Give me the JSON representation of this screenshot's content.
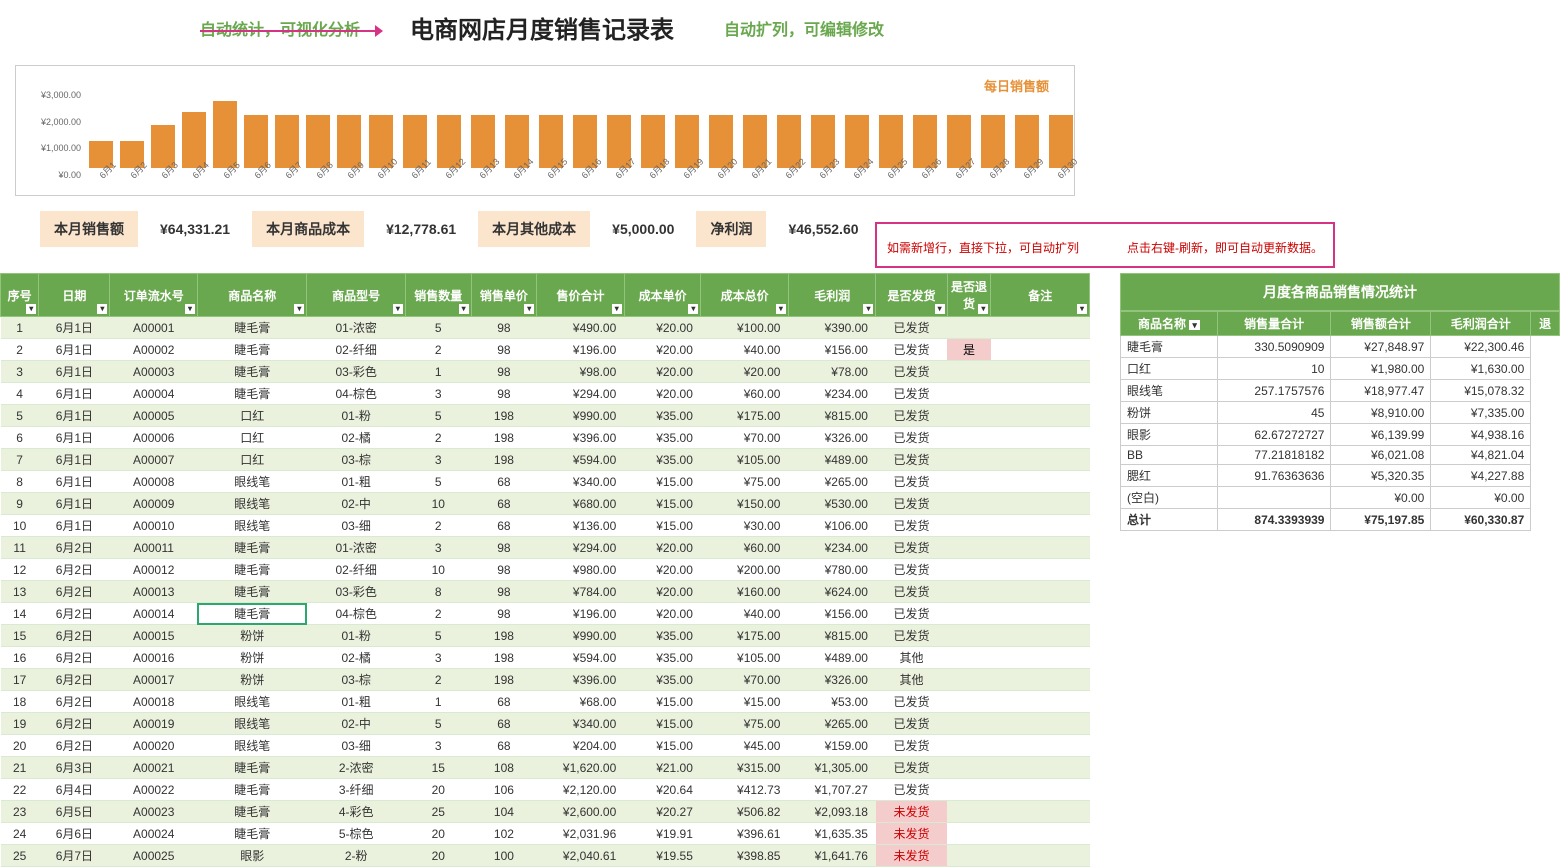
{
  "titles": {
    "note_left": "自动统计，可视化分析",
    "main": "电商网店月度销售记录表",
    "note_right": "自动扩列，可编辑修改"
  },
  "chart": {
    "legend": "每日销售额",
    "y_ticks": [
      "¥3,000.00",
      "¥2,000.00",
      "¥1,000.00",
      "¥0.00"
    ]
  },
  "chart_data": {
    "type": "bar",
    "title": "每日销售额",
    "xlabel": "",
    "ylabel": "",
    "ylim": [
      0,
      3000
    ],
    "categories": [
      "6月1",
      "6月2",
      "6月3",
      "6月4",
      "6月5",
      "6月6",
      "6月7",
      "6月8",
      "6月9",
      "6月10",
      "6月11",
      "6月12",
      "6月13",
      "6月14",
      "6月15",
      "6月16",
      "6月17",
      "6月18",
      "6月19",
      "6月20",
      "6月21",
      "6月22",
      "6月23",
      "6月24",
      "6月25",
      "6月26",
      "6月27",
      "6月28",
      "6月29",
      "6月30"
    ],
    "values": [
      1000,
      1000,
      1600,
      2100,
      2500,
      2000,
      2000,
      2000,
      2000,
      2000,
      2000,
      2000,
      2000,
      2000,
      2000,
      2000,
      2000,
      2000,
      2000,
      2000,
      2000,
      2000,
      2000,
      2000,
      2000,
      2000,
      2000,
      2000,
      2000,
      2000
    ]
  },
  "summary": {
    "labels": [
      "本月销售额",
      "本月商品成本",
      "本月其他成本",
      "净利润"
    ],
    "values": [
      "¥64,331.21",
      "¥12,778.61",
      "¥5,000.00",
      "¥46,552.60"
    ]
  },
  "red_notes": {
    "left": "如需新增行，直接下拉，可自动扩列",
    "right": "点击右键-刷新，即可自动更新数据。"
  },
  "main_table": {
    "headers": [
      "序号",
      "日期",
      "订单流水号",
      "商品名称",
      "商品型号",
      "销售数量",
      "销售单价",
      "售价合计",
      "成本单价",
      "成本总价",
      "毛利润",
      "是否发货",
      "是否退货",
      "备注"
    ],
    "rows": [
      [
        "1",
        "6月1日",
        "A00001",
        "睫毛膏",
        "01-浓密",
        "5",
        "98",
        "¥490.00",
        "¥20.00",
        "¥100.00",
        "¥390.00",
        "已发货",
        "",
        ""
      ],
      [
        "2",
        "6月1日",
        "A00002",
        "睫毛膏",
        "02-纤细",
        "2",
        "98",
        "¥196.00",
        "¥20.00",
        "¥40.00",
        "¥156.00",
        "已发货",
        "是",
        ""
      ],
      [
        "3",
        "6月1日",
        "A00003",
        "睫毛膏",
        "03-彩色",
        "1",
        "98",
        "¥98.00",
        "¥20.00",
        "¥20.00",
        "¥78.00",
        "已发货",
        "",
        ""
      ],
      [
        "4",
        "6月1日",
        "A00004",
        "睫毛膏",
        "04-棕色",
        "3",
        "98",
        "¥294.00",
        "¥20.00",
        "¥60.00",
        "¥234.00",
        "已发货",
        "",
        ""
      ],
      [
        "5",
        "6月1日",
        "A00005",
        "口红",
        "01-粉",
        "5",
        "198",
        "¥990.00",
        "¥35.00",
        "¥175.00",
        "¥815.00",
        "已发货",
        "",
        ""
      ],
      [
        "6",
        "6月1日",
        "A00006",
        "口红",
        "02-橘",
        "2",
        "198",
        "¥396.00",
        "¥35.00",
        "¥70.00",
        "¥326.00",
        "已发货",
        "",
        ""
      ],
      [
        "7",
        "6月1日",
        "A00007",
        "口红",
        "03-棕",
        "3",
        "198",
        "¥594.00",
        "¥35.00",
        "¥105.00",
        "¥489.00",
        "已发货",
        "",
        ""
      ],
      [
        "8",
        "6月1日",
        "A00008",
        "眼线笔",
        "01-粗",
        "5",
        "68",
        "¥340.00",
        "¥15.00",
        "¥75.00",
        "¥265.00",
        "已发货",
        "",
        ""
      ],
      [
        "9",
        "6月1日",
        "A00009",
        "眼线笔",
        "02-中",
        "10",
        "68",
        "¥680.00",
        "¥15.00",
        "¥150.00",
        "¥530.00",
        "已发货",
        "",
        ""
      ],
      [
        "10",
        "6月1日",
        "A00010",
        "眼线笔",
        "03-细",
        "2",
        "68",
        "¥136.00",
        "¥15.00",
        "¥30.00",
        "¥106.00",
        "已发货",
        "",
        ""
      ],
      [
        "11",
        "6月2日",
        "A00011",
        "睫毛膏",
        "01-浓密",
        "3",
        "98",
        "¥294.00",
        "¥20.00",
        "¥60.00",
        "¥234.00",
        "已发货",
        "",
        ""
      ],
      [
        "12",
        "6月2日",
        "A00012",
        "睫毛膏",
        "02-纤细",
        "10",
        "98",
        "¥980.00",
        "¥20.00",
        "¥200.00",
        "¥780.00",
        "已发货",
        "",
        ""
      ],
      [
        "13",
        "6月2日",
        "A00013",
        "睫毛膏",
        "03-彩色",
        "8",
        "98",
        "¥784.00",
        "¥20.00",
        "¥160.00",
        "¥624.00",
        "已发货",
        "",
        ""
      ],
      [
        "14",
        "6月2日",
        "A00014",
        "睫毛膏",
        "04-棕色",
        "2",
        "98",
        "¥196.00",
        "¥20.00",
        "¥40.00",
        "¥156.00",
        "已发货",
        "",
        ""
      ],
      [
        "15",
        "6月2日",
        "A00015",
        "粉饼",
        "01-粉",
        "5",
        "198",
        "¥990.00",
        "¥35.00",
        "¥175.00",
        "¥815.00",
        "已发货",
        "",
        ""
      ],
      [
        "16",
        "6月2日",
        "A00016",
        "粉饼",
        "02-橘",
        "3",
        "198",
        "¥594.00",
        "¥35.00",
        "¥105.00",
        "¥489.00",
        "其他",
        "",
        ""
      ],
      [
        "17",
        "6月2日",
        "A00017",
        "粉饼",
        "03-棕",
        "2",
        "198",
        "¥396.00",
        "¥35.00",
        "¥70.00",
        "¥326.00",
        "其他",
        "",
        ""
      ],
      [
        "18",
        "6月2日",
        "A00018",
        "眼线笔",
        "01-粗",
        "1",
        "68",
        "¥68.00",
        "¥15.00",
        "¥15.00",
        "¥53.00",
        "已发货",
        "",
        ""
      ],
      [
        "19",
        "6月2日",
        "A00019",
        "眼线笔",
        "02-中",
        "5",
        "68",
        "¥340.00",
        "¥15.00",
        "¥75.00",
        "¥265.00",
        "已发货",
        "",
        ""
      ],
      [
        "20",
        "6月2日",
        "A00020",
        "眼线笔",
        "03-细",
        "3",
        "68",
        "¥204.00",
        "¥15.00",
        "¥45.00",
        "¥159.00",
        "已发货",
        "",
        ""
      ],
      [
        "21",
        "6月3日",
        "A00021",
        "睫毛膏",
        "2-浓密",
        "15",
        "108",
        "¥1,620.00",
        "¥21.00",
        "¥315.00",
        "¥1,305.00",
        "已发货",
        "",
        ""
      ],
      [
        "22",
        "6月4日",
        "A00022",
        "睫毛膏",
        "3-纤细",
        "20",
        "106",
        "¥2,120.00",
        "¥20.64",
        "¥412.73",
        "¥1,707.27",
        "已发货",
        "",
        ""
      ],
      [
        "23",
        "6月5日",
        "A00023",
        "睫毛膏",
        "4-彩色",
        "25",
        "104",
        "¥2,600.00",
        "¥20.27",
        "¥506.82",
        "¥2,093.18",
        "未发货",
        "",
        ""
      ],
      [
        "24",
        "6月6日",
        "A00024",
        "睫毛膏",
        "5-棕色",
        "20",
        "102",
        "¥2,031.96",
        "¥19.91",
        "¥396.61",
        "¥1,635.35",
        "未发货",
        "",
        ""
      ],
      [
        "25",
        "6月7日",
        "A00025",
        "眼影",
        "2-粉",
        "20",
        "100",
        "¥2,040.61",
        "¥19.55",
        "¥398.85",
        "¥1,641.76",
        "未发货",
        "",
        ""
      ]
    ]
  },
  "pivot": {
    "title": "月度各商品销售情况统计",
    "headers": [
      "商品名称",
      "销售量合计",
      "销售额合计",
      "毛利润合计",
      "退"
    ],
    "rows": [
      [
        "睫毛膏",
        "330.5090909",
        "¥27,848.97",
        "¥22,300.46"
      ],
      [
        "口红",
        "10",
        "¥1,980.00",
        "¥1,630.00"
      ],
      [
        "眼线笔",
        "257.1757576",
        "¥18,977.47",
        "¥15,078.32"
      ],
      [
        "粉饼",
        "45",
        "¥8,910.00",
        "¥7,335.00"
      ],
      [
        "眼影",
        "62.67272727",
        "¥6,139.99",
        "¥4,938.16"
      ],
      [
        "BB",
        "77.21818182",
        "¥6,021.08",
        "¥4,821.04"
      ],
      [
        "腮红",
        "91.76363636",
        "¥5,320.35",
        "¥4,227.88"
      ],
      [
        "(空白)",
        "",
        "¥0.00",
        "¥0.00"
      ]
    ],
    "total": [
      "总计",
      "874.3393939",
      "¥75,197.85",
      "¥60,330.87"
    ]
  }
}
